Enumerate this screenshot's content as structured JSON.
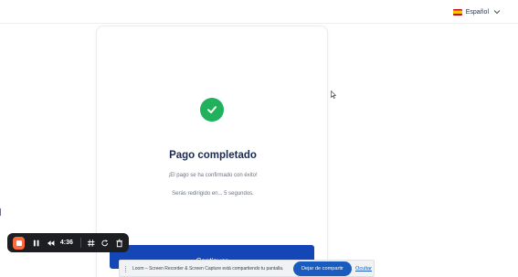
{
  "header": {
    "language_label": "Español",
    "language_flag_icon": "flag-es-icon",
    "dropdown_icon": "chevron-down-icon"
  },
  "card": {
    "status_icon": "check-circle-icon",
    "title": "Pago completado",
    "message": "¡El pago se ha confirmado con éxito!",
    "redirect_text": "Serás redirigido en... 5 segundos.",
    "continue_label": "Continuar"
  },
  "recorder": {
    "timer": "4:36",
    "icons": [
      "stop-icon",
      "pause-icon",
      "rewind-icon",
      "grid-icon",
      "restart-icon",
      "trash-icon"
    ]
  },
  "share_bar": {
    "text": "Loom – Screen Recorder & Screen Capture está compartiendo tu pantalla.",
    "stop_sharing_label": "Dejar de compartir",
    "hide_label": "Ocultar"
  },
  "colors": {
    "success": "#1fb15c",
    "primary": "#1546b8",
    "title": "#1b2a52",
    "recorder_bg": "#1d1e22",
    "record_accent": "#ff6a3d"
  }
}
